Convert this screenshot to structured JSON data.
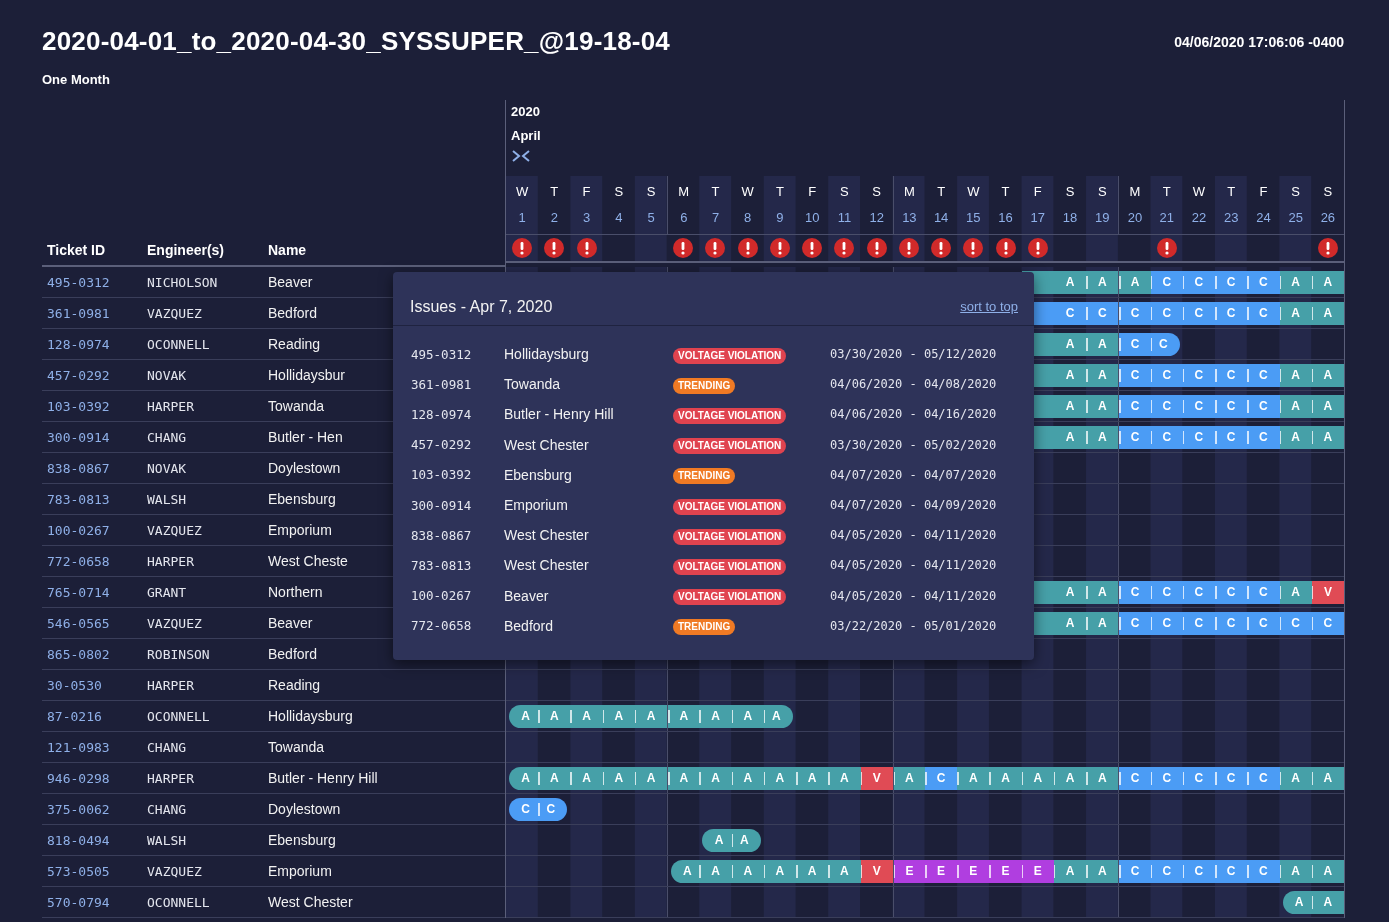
{
  "header": {
    "title": "2020-04-01_to_2020-04-30_SYSSUPER_@19-18-04",
    "subtitle": "One Month",
    "timestamp": "04/06/2020 17:06:06 -0400"
  },
  "table": {
    "columns": [
      "Ticket ID",
      "Engineer(s)",
      "Name"
    ]
  },
  "calendar": {
    "year": "2020",
    "month": "April",
    "days": [
      {
        "weekday": "W",
        "date": "1",
        "issue": true,
        "week_start": false
      },
      {
        "weekday": "T",
        "date": "2",
        "issue": true,
        "week_start": false
      },
      {
        "weekday": "F",
        "date": "3",
        "issue": true,
        "week_start": false
      },
      {
        "weekday": "S",
        "date": "4",
        "issue": false,
        "week_start": false
      },
      {
        "weekday": "S",
        "date": "5",
        "issue": false,
        "week_start": false
      },
      {
        "weekday": "M",
        "date": "6",
        "issue": true,
        "week_start": true
      },
      {
        "weekday": "T",
        "date": "7",
        "issue": true,
        "week_start": false
      },
      {
        "weekday": "W",
        "date": "8",
        "issue": true,
        "week_start": false
      },
      {
        "weekday": "T",
        "date": "9",
        "issue": true,
        "week_start": false
      },
      {
        "weekday": "F",
        "date": "10",
        "issue": true,
        "week_start": false
      },
      {
        "weekday": "S",
        "date": "11",
        "issue": true,
        "week_start": false
      },
      {
        "weekday": "S",
        "date": "12",
        "issue": true,
        "week_start": false
      },
      {
        "weekday": "M",
        "date": "13",
        "issue": true,
        "week_start": true
      },
      {
        "weekday": "T",
        "date": "14",
        "issue": true,
        "week_start": false
      },
      {
        "weekday": "W",
        "date": "15",
        "issue": true,
        "week_start": false
      },
      {
        "weekday": "T",
        "date": "16",
        "issue": true,
        "week_start": false
      },
      {
        "weekday": "F",
        "date": "17",
        "issue": true,
        "week_start": false
      },
      {
        "weekday": "S",
        "date": "18",
        "issue": false,
        "week_start": false
      },
      {
        "weekday": "S",
        "date": "19",
        "issue": false,
        "week_start": false
      },
      {
        "weekday": "M",
        "date": "20",
        "issue": false,
        "week_start": true
      },
      {
        "weekday": "T",
        "date": "21",
        "issue": true,
        "week_start": false
      },
      {
        "weekday": "W",
        "date": "22",
        "issue": false,
        "week_start": false
      },
      {
        "weekday": "T",
        "date": "23",
        "issue": false,
        "week_start": false
      },
      {
        "weekday": "F",
        "date": "24",
        "issue": false,
        "week_start": false
      },
      {
        "weekday": "S",
        "date": "25",
        "issue": false,
        "week_start": false
      },
      {
        "weekday": "S",
        "date": "26",
        "issue": true,
        "week_start": false
      }
    ]
  },
  "rows": [
    {
      "ticket": "495-0312",
      "engineer": "NICHOLSON",
      "name": "Beaver",
      "continues_left": true,
      "cells": [
        null,
        null,
        null,
        null,
        null,
        null,
        null,
        null,
        null,
        null,
        null,
        null,
        null,
        null,
        null,
        null,
        null,
        "A",
        "A",
        "A",
        "C",
        "C",
        "C",
        "C",
        "A",
        "A"
      ]
    },
    {
      "ticket": "361-0981",
      "engineer": "VAZQUEZ",
      "name": "Bedford",
      "continues_left": true,
      "cells": [
        null,
        null,
        null,
        null,
        null,
        null,
        null,
        null,
        null,
        null,
        null,
        null,
        null,
        null,
        null,
        null,
        null,
        "C",
        "C",
        "C",
        "C",
        "C",
        "C",
        "C",
        "A",
        "A"
      ]
    },
    {
      "ticket": "128-0974",
      "engineer": "OCONNELL",
      "name": "Reading",
      "continues_left": true,
      "cells": [
        null,
        null,
        null,
        null,
        null,
        null,
        null,
        null,
        null,
        null,
        null,
        null,
        null,
        null,
        null,
        null,
        null,
        "A",
        "A",
        "C",
        "C",
        null,
        null,
        null,
        null,
        null
      ]
    },
    {
      "ticket": "457-0292",
      "engineer": "NOVAK",
      "name": "Hollidaysbur",
      "continues_left": true,
      "cells": [
        null,
        null,
        null,
        null,
        null,
        null,
        null,
        null,
        null,
        null,
        null,
        null,
        null,
        null,
        null,
        null,
        null,
        "A",
        "A",
        "C",
        "C",
        "C",
        "C",
        "C",
        "A",
        "A"
      ]
    },
    {
      "ticket": "103-0392",
      "engineer": "HARPER",
      "name": "Towanda",
      "continues_left": true,
      "cells": [
        null,
        null,
        null,
        null,
        null,
        null,
        null,
        null,
        null,
        null,
        null,
        null,
        null,
        null,
        null,
        null,
        null,
        "A",
        "A",
        "C",
        "C",
        "C",
        "C",
        "C",
        "A",
        "A"
      ]
    },
    {
      "ticket": "300-0914",
      "engineer": "CHANG",
      "name": "Butler - Hen",
      "continues_left": true,
      "cells": [
        null,
        null,
        null,
        null,
        null,
        null,
        null,
        null,
        null,
        null,
        null,
        null,
        null,
        null,
        null,
        null,
        null,
        "A",
        "A",
        "C",
        "C",
        "C",
        "C",
        "C",
        "A",
        "A"
      ]
    },
    {
      "ticket": "838-0867",
      "engineer": "NOVAK",
      "name": "Doylestown"
    },
    {
      "ticket": "783-0813",
      "engineer": "WALSH",
      "name": "Ebensburg"
    },
    {
      "ticket": "100-0267",
      "engineer": "VAZQUEZ",
      "name": "Emporium"
    },
    {
      "ticket": "772-0658",
      "engineer": "HARPER",
      "name": "West Cheste"
    },
    {
      "ticket": "765-0714",
      "engineer": "GRANT",
      "name": "Northern",
      "continues_left": true,
      "cells": [
        null,
        null,
        null,
        null,
        null,
        null,
        null,
        null,
        null,
        null,
        null,
        null,
        null,
        null,
        null,
        null,
        null,
        "A",
        "A",
        "C",
        "C",
        "C",
        "C",
        "C",
        "A",
        "V"
      ]
    },
    {
      "ticket": "546-0565",
      "engineer": "VAZQUEZ",
      "name": "Beaver",
      "continues_left": true,
      "cells": [
        null,
        null,
        null,
        null,
        null,
        null,
        null,
        null,
        null,
        null,
        null,
        null,
        null,
        null,
        null,
        null,
        null,
        "A",
        "A",
        "C",
        "C",
        "C",
        "C",
        "C",
        "C",
        "C"
      ]
    },
    {
      "ticket": "865-0802",
      "engineer": "ROBINSON",
      "name": "Bedford"
    },
    {
      "ticket": "30-0530",
      "engineer": "HARPER",
      "name": "Reading"
    },
    {
      "ticket": "87-0216",
      "engineer": "OCONNELL",
      "name": "Hollidaysburg",
      "continues_left": false,
      "cells": [
        "A",
        "A",
        "A",
        "A",
        "A",
        "A",
        "A",
        "A",
        "A",
        null,
        null,
        null,
        null,
        null,
        null,
        null,
        null,
        null,
        null,
        null,
        null,
        null,
        null,
        null,
        null,
        null
      ]
    },
    {
      "ticket": "121-0983",
      "engineer": "CHANG",
      "name": "Towanda"
    },
    {
      "ticket": "946-0298",
      "engineer": "HARPER",
      "name": "Butler - Henry Hill",
      "continues_left": false,
      "cells": [
        "A",
        "A",
        "A",
        "A",
        "A",
        "A",
        "A",
        "A",
        "A",
        "A",
        "A",
        "V",
        "A",
        "C",
        "A",
        "A",
        "A",
        "A",
        "A",
        "C",
        "C",
        "C",
        "C",
        "C",
        "A",
        "A"
      ]
    },
    {
      "ticket": "375-0062",
      "engineer": "CHANG",
      "name": "Doylestown",
      "continues_left": false,
      "cells": [
        "C",
        "C",
        null,
        null,
        null,
        null,
        null,
        null,
        null,
        null,
        null,
        null,
        null,
        null,
        null,
        null,
        null,
        null,
        null,
        null,
        null,
        null,
        null,
        null,
        null,
        null
      ]
    },
    {
      "ticket": "818-0494",
      "engineer": "WALSH",
      "name": "Ebensburg",
      "continues_left": false,
      "cells": [
        null,
        null,
        null,
        null,
        null,
        null,
        "A",
        "A",
        null,
        null,
        null,
        null,
        null,
        null,
        null,
        null,
        null,
        null,
        null,
        null,
        null,
        null,
        null,
        null,
        null,
        null
      ]
    },
    {
      "ticket": "573-0505",
      "engineer": "VAZQUEZ",
      "name": "Emporium",
      "continues_left": false,
      "cells": [
        null,
        null,
        null,
        null,
        null,
        "A",
        "A",
        "A",
        "A",
        "A",
        "A",
        "V",
        "E",
        "E",
        "E",
        "E",
        "E",
        "A",
        "A",
        "C",
        "C",
        "C",
        "C",
        "C",
        "A",
        "A"
      ]
    },
    {
      "ticket": "570-0794",
      "engineer": "OCONNELL",
      "name": "West Chester",
      "continues_left": false,
      "cells": [
        null,
        null,
        null,
        null,
        null,
        null,
        null,
        null,
        null,
        null,
        null,
        null,
        null,
        null,
        null,
        null,
        null,
        null,
        null,
        null,
        null,
        null,
        null,
        null,
        "A",
        "A"
      ]
    }
  ],
  "popup": {
    "title": "Issues - Apr 7, 2020",
    "link": "sort to top",
    "issues": [
      {
        "ticket": "495-0312",
        "name": "Hollidaysburg",
        "kind": "voltage",
        "tag": "VOLTAGE VIOLATION",
        "dates": "03/30/2020 - 05/12/2020"
      },
      {
        "ticket": "361-0981",
        "name": "Towanda",
        "kind": "trending",
        "tag": "TRENDING",
        "dates": "04/06/2020 - 04/08/2020"
      },
      {
        "ticket": "128-0974",
        "name": "Butler - Henry Hill",
        "kind": "voltage",
        "tag": "VOLTAGE VIOLATION",
        "dates": "04/06/2020 - 04/16/2020"
      },
      {
        "ticket": "457-0292",
        "name": "West Chester",
        "kind": "voltage",
        "tag": "VOLTAGE VIOLATION",
        "dates": "03/30/2020 - 05/02/2020"
      },
      {
        "ticket": "103-0392",
        "name": "Ebensburg",
        "kind": "trending",
        "tag": "TRENDING",
        "dates": "04/07/2020 - 04/07/2020"
      },
      {
        "ticket": "300-0914",
        "name": "Emporium",
        "kind": "voltage",
        "tag": "VOLTAGE VIOLATION",
        "dates": "04/07/2020 - 04/09/2020"
      },
      {
        "ticket": "838-0867",
        "name": "West Chester",
        "kind": "voltage",
        "tag": "VOLTAGE VIOLATION",
        "dates": "04/05/2020 - 04/11/2020"
      },
      {
        "ticket": "783-0813",
        "name": "West Chester",
        "kind": "voltage",
        "tag": "VOLTAGE VIOLATION",
        "dates": "04/05/2020 - 04/11/2020"
      },
      {
        "ticket": "100-0267",
        "name": "Beaver",
        "kind": "voltage",
        "tag": "VOLTAGE VIOLATION",
        "dates": "04/05/2020 - 04/11/2020"
      },
      {
        "ticket": "772-0658",
        "name": "Bedford",
        "kind": "trending",
        "tag": "TRENDING",
        "dates": "03/22/2020 - 05/01/2020"
      }
    ]
  }
}
